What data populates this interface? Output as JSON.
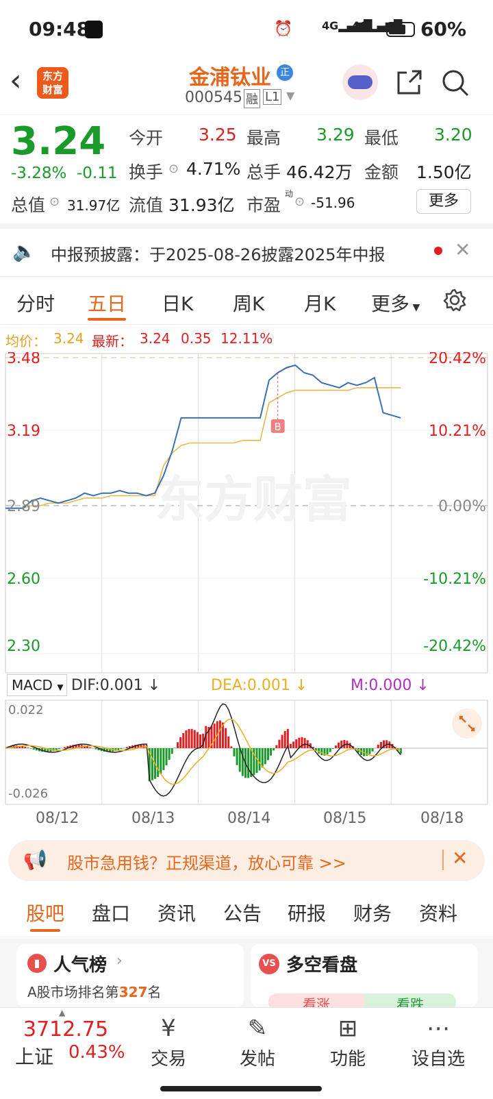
{
  "status": {
    "time": "09:48",
    "battery": "60%",
    "network1": "4G",
    "network2": "4G"
  },
  "header": {
    "logo_line1": "东方",
    "logo_line2": "财富",
    "title": "金浦钛业",
    "badge": "正",
    "code": "000545",
    "tag_margin": "融",
    "tag_level": "L1"
  },
  "quote": {
    "price": "3.24",
    "change_pct": "-3.28%",
    "change_abs": "-0.11",
    "open_label": "今开",
    "open": "3.25",
    "high_label": "最高",
    "high": "3.29",
    "low_label": "最低",
    "low": "3.20",
    "turnover_label": "换手",
    "turnover": "4.71%",
    "volume_label": "总手",
    "volume": "46.42万",
    "amount_label": "金额",
    "amount": "1.50亿",
    "mktcap_label": "总值",
    "mktcap": "31.97亿",
    "float_label": "流值",
    "float": "31.93亿",
    "pe_label": "市盈",
    "pe_sup": "动",
    "pe": "-51.96",
    "more_label": "更多"
  },
  "notice": {
    "text": "中报预披露：于2025-08-26披露2025年中报"
  },
  "tabs": [
    "分时",
    "五日",
    "日K",
    "周K",
    "月K",
    "更多"
  ],
  "active_tab": 1,
  "chart_info": {
    "avg_label": "均价：",
    "avg": "3.24",
    "latest_label": "最新：",
    "latest": "3.24",
    "latest_change": "0.35",
    "latest_pct": "12.11%"
  },
  "chart_data": {
    "type": "line",
    "y_ticks_left": [
      "3.48",
      "3.19",
      "2.89",
      "2.60",
      "2.30"
    ],
    "y_ticks_right": [
      "20.42%",
      "10.21%",
      "0.00%",
      "-10.21%",
      "-20.42%"
    ],
    "ylim": [
      2.3,
      3.48
    ],
    "prev_close": 2.89,
    "x_labels": [
      "08/12",
      "08/13",
      "08/14",
      "08/15",
      "08/18"
    ],
    "series": [
      {
        "name": "price",
        "color": "#3a6fb5",
        "values": [
          2.88,
          2.88,
          2.88,
          2.91,
          2.92,
          2.91,
          2.9,
          2.91,
          2.92,
          2.94,
          2.93,
          2.94,
          2.94,
          2.95,
          2.94,
          2.94,
          2.93,
          2.94,
          3.01,
          3.11,
          3.24,
          3.24,
          3.24,
          3.24,
          3.24,
          3.24,
          3.24,
          3.24,
          3.24,
          3.24,
          3.39,
          3.42,
          3.44,
          3.45,
          3.42,
          3.41,
          3.38,
          3.37,
          3.36,
          3.38,
          3.37,
          3.38,
          3.4,
          3.26,
          3.25,
          3.24
        ]
      },
      {
        "name": "avg",
        "color": "#e8b84a",
        "values": [
          2.88,
          2.88,
          2.88,
          2.89,
          2.89,
          2.9,
          2.9,
          2.9,
          2.91,
          2.92,
          2.92,
          2.92,
          2.93,
          2.93,
          2.93,
          2.93,
          2.93,
          2.93,
          3.05,
          3.1,
          3.13,
          3.14,
          3.14,
          3.14,
          3.14,
          3.14,
          3.14,
          3.15,
          3.15,
          3.15,
          3.3,
          3.32,
          3.34,
          3.35,
          3.35,
          3.35,
          3.35,
          3.35,
          3.35,
          3.35,
          3.36,
          3.36,
          3.36,
          3.36,
          3.36,
          3.36
        ]
      }
    ],
    "marker_label": "B"
  },
  "macd": {
    "selector": "MACD",
    "dif_label": "DIF:0.001",
    "dea_label": "DEA:0.001",
    "m_label": "M:0.000",
    "y_top": "0.022",
    "y_bottom": "-0.026"
  },
  "banner": {
    "text": "股市急用钱？正规渠道，放心可靠 >>"
  },
  "subtabs": [
    "股吧",
    "盘口",
    "资讯",
    "公告",
    "研报",
    "财务",
    "资料"
  ],
  "active_subtab": 0,
  "cards": {
    "left_title": "人气榜",
    "left_sub_prefix": "A股市场排名第",
    "left_rank": "327",
    "left_sub_suffix": "名",
    "right_icon": "VS",
    "right_title": "多空看盘",
    "right_up": "看涨",
    "right_down": "看跌"
  },
  "bottom": {
    "index_value": "3712.75",
    "index_name": "上证",
    "index_pct": "0.43%",
    "nav": [
      "交易",
      "发帖",
      "功能",
      "设自选"
    ]
  },
  "colors": {
    "up": "#e02020",
    "down": "#1a9a2a",
    "accent": "#e8661c",
    "price_line": "#3a6fb5",
    "avg_line": "#e8b84a"
  }
}
